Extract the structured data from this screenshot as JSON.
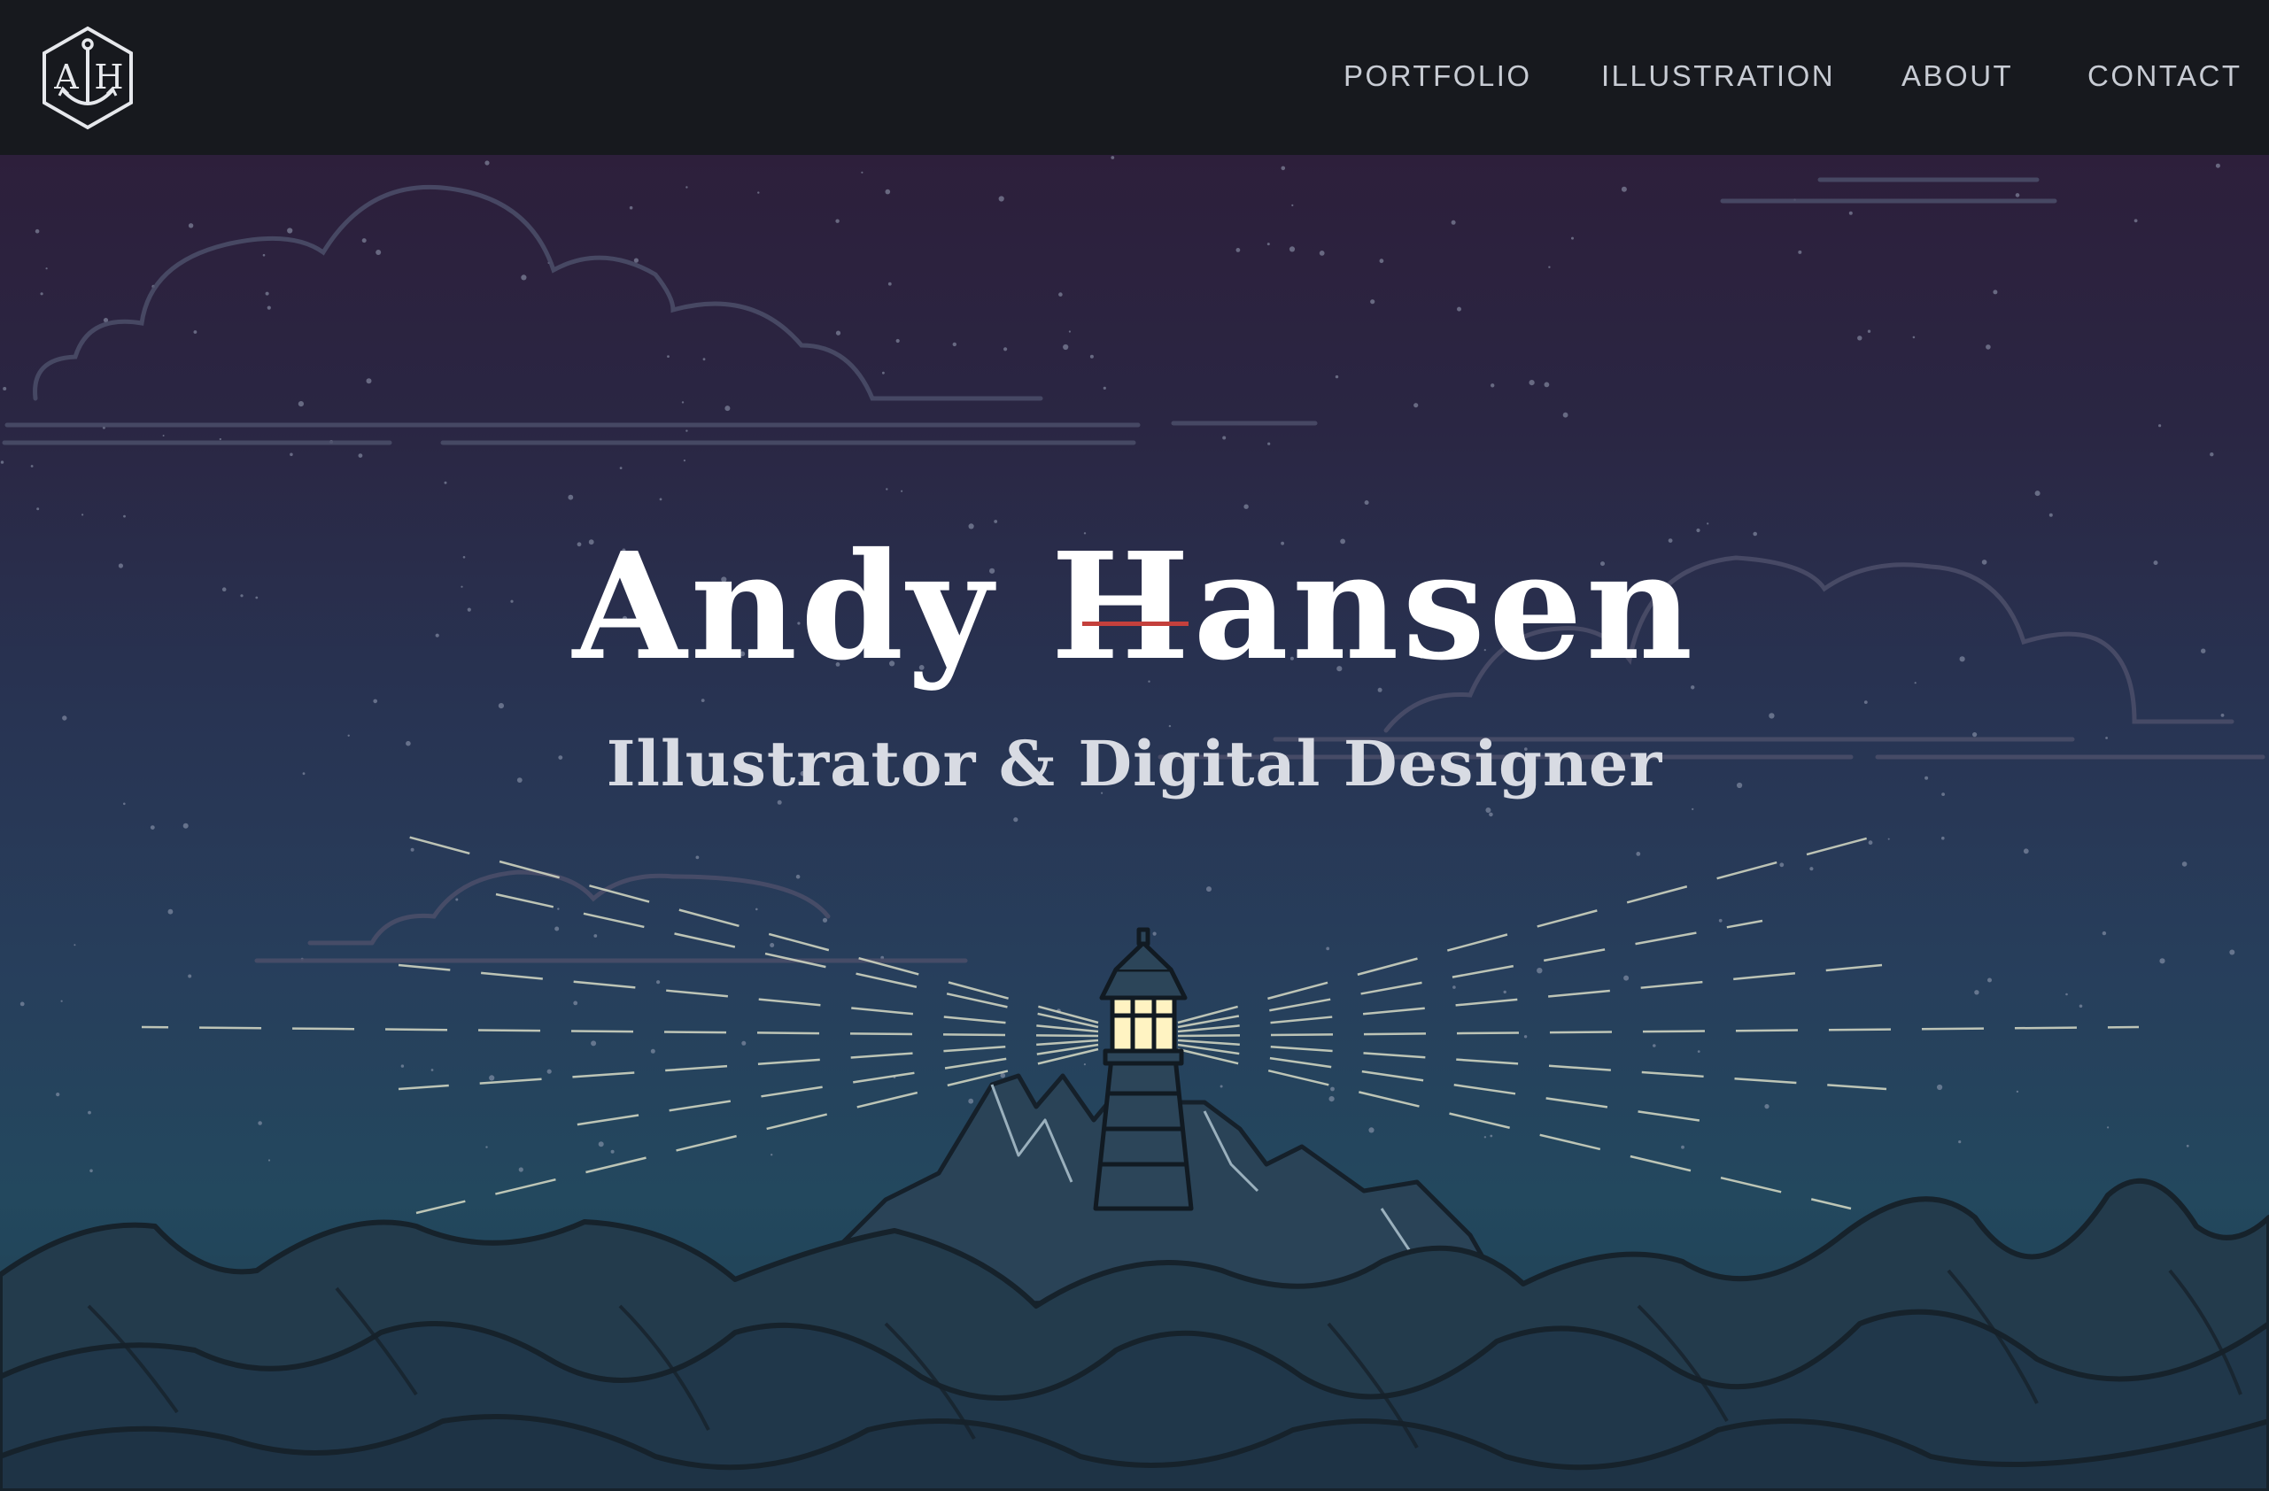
{
  "brand": {
    "logo_monogram": "AH",
    "logo_icon": "anchor-hexagon-icon"
  },
  "nav": {
    "items": [
      {
        "label": "PORTFOLIO"
      },
      {
        "label": "ILLUSTRATION"
      },
      {
        "label": "ABOUT"
      },
      {
        "label": "CONTACT"
      }
    ]
  },
  "hero": {
    "name": "Andy Hansen",
    "tagline": "Illustrator & Digital Designer",
    "illustration": "night-sea-lighthouse-illustration"
  },
  "colors": {
    "navbar_bg": "#17191e",
    "nav_text": "#c8ccd4",
    "accent_rule": "#c4403c",
    "sky_top": "#2d1f3b",
    "sky_bottom": "#23485e",
    "sea": "#22394a",
    "light_beam": "#d9dcc8",
    "lamp_glow": "#fff3c2"
  }
}
